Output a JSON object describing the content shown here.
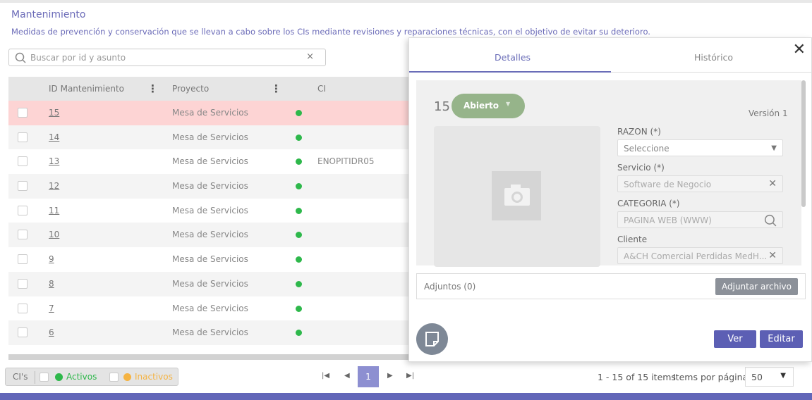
{
  "header": {
    "title": "Mantenimiento",
    "description": "Medidas de prevención y conservación que se llevan a cabo sobre los CIs mediante revisiones y reparaciones técnicas, con el objetivo de evitar su deterioro."
  },
  "search": {
    "placeholder": "Buscar por id y asunto",
    "clear": "×"
  },
  "grid": {
    "columns": {
      "id": "ID Mantenimiento",
      "project": "Proyecto",
      "ci": "CI"
    },
    "rows": [
      {
        "id": "15",
        "project": "Mesa de Servicios",
        "ci": "",
        "selected": true
      },
      {
        "id": "14",
        "project": "Mesa de Servicios",
        "ci": ""
      },
      {
        "id": "13",
        "project": "Mesa de Servicios",
        "ci": "ENOPITIDR05"
      },
      {
        "id": "12",
        "project": "Mesa de Servicios",
        "ci": ""
      },
      {
        "id": "11",
        "project": "Mesa de Servicios",
        "ci": ""
      },
      {
        "id": "10",
        "project": "Mesa de Servicios",
        "ci": ""
      },
      {
        "id": "9",
        "project": "Mesa de Servicios",
        "ci": ""
      },
      {
        "id": "8",
        "project": "Mesa de Servicios",
        "ci": ""
      },
      {
        "id": "7",
        "project": "Mesa de Servicios",
        "ci": ""
      },
      {
        "id": "6",
        "project": "Mesa de Servicios",
        "ci": ""
      }
    ]
  },
  "legend": {
    "label": "CI's",
    "active": "Activos",
    "inactive": "Inactivos"
  },
  "pagination": {
    "current_page": "1",
    "info": "1 - 15 of 15 items",
    "per_page_label": "Items por página",
    "per_page_value": "50"
  },
  "panel": {
    "tabs": [
      "Detalles",
      "Histórico"
    ],
    "close": "✕",
    "number": "15",
    "status": "Abierto",
    "version": "Versión 1",
    "fields": [
      {
        "label": "RAZON (*)",
        "value": "Seleccione",
        "icon": "chevron-down-icon"
      },
      {
        "label": "Servicio (*)",
        "value": "Software de Negocio",
        "icon": "clear-icon"
      },
      {
        "label": "CATEGORIA (*)",
        "value": "PAGINA WEB (WWW)",
        "icon": "search-icon"
      },
      {
        "label": "Cliente",
        "value": "A&CH Comercial Perdidas MedH...",
        "icon": "clear-icon"
      }
    ],
    "attachments_label": "Adjuntos (0)",
    "attach_button": "Adjuntar archivo",
    "view_button": "Ver",
    "edit_button": "Editar"
  },
  "colors": {
    "accent": "#6266b8",
    "active": "#2eb84b",
    "inactive": "#f5b342",
    "selected_row": "#fdd4d4",
    "status": "#96b48a"
  }
}
